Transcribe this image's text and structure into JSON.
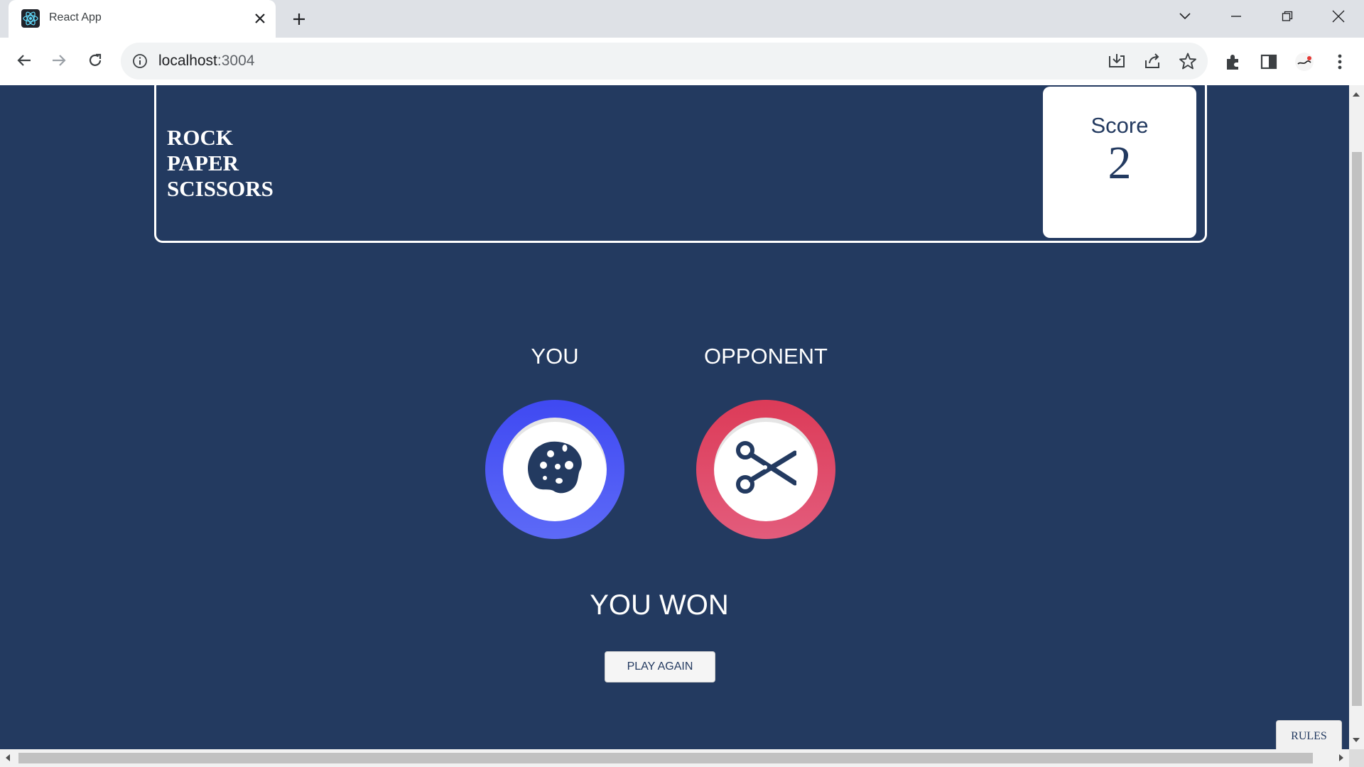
{
  "browser": {
    "tab_title": "React App",
    "url_host": "localhost",
    "url_port": ":3004"
  },
  "game": {
    "title_lines": [
      "ROCK",
      "PAPER",
      "SCISSORS"
    ],
    "score_label": "Score",
    "score_value": "2",
    "you_label": "YOU",
    "opponent_label": "OPPONENT",
    "you_choice": "rock-icon",
    "opponent_choice": "scissors-icon",
    "result_text": "YOU WON",
    "play_again_label": "PLAY AGAIN",
    "rules_label": "RULES"
  },
  "colors": {
    "background": "#233a60",
    "rock_ring": "#3f49f2",
    "scissors_ring": "#dc3b58"
  }
}
